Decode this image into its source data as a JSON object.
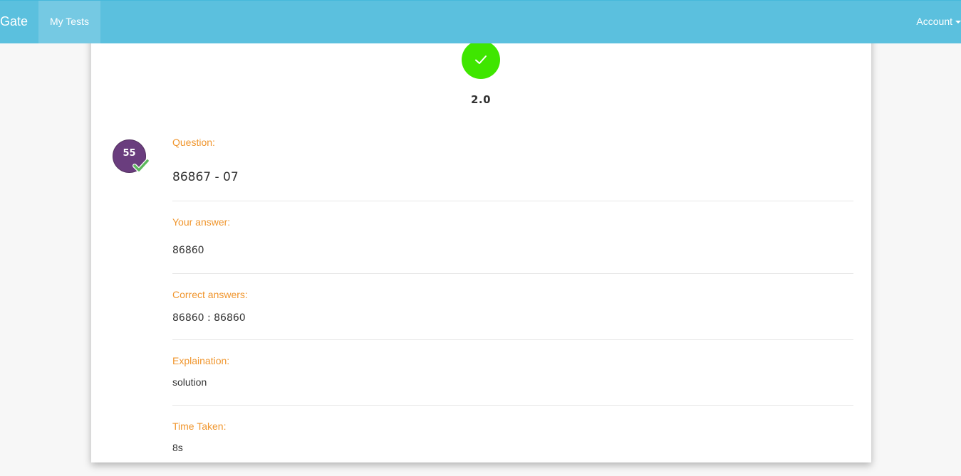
{
  "nav": {
    "brand": "Gate",
    "tab_my_tests": "My Tests",
    "account": "Account"
  },
  "result": {
    "score": "2.0"
  },
  "question": {
    "number": "55",
    "status": "correct",
    "question_label": "Question:",
    "question_text": "86867 - 07",
    "your_answer_label": "Your answer:",
    "your_answer": "86860",
    "correct_answers_label": "Correct answers:",
    "correct_answers": "86860 : 86860",
    "explanation_label": "Explaination:",
    "explanation": "solution",
    "time_label": "Time Taken:",
    "time": "8s"
  },
  "colors": {
    "navbar": "#5bc0de",
    "active_tab": "#75c9e3",
    "score_circle": "#3fe600",
    "question_badge": "#6a3d7e",
    "label": "#f0962e"
  },
  "icons": {
    "score": "check-icon",
    "badge": "check-badge-icon",
    "account": "caret-down-icon"
  }
}
